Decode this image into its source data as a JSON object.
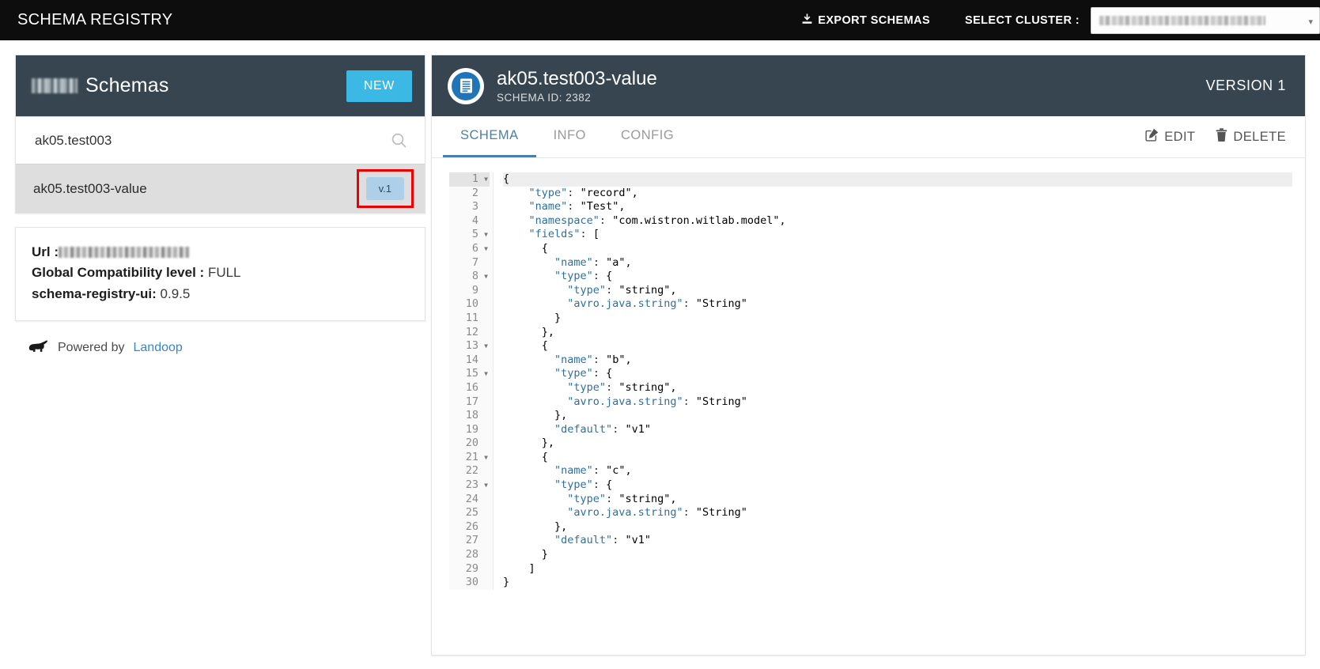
{
  "topnav": {
    "brand": "SCHEMA REGISTRY",
    "export_label": "EXPORT SCHEMAS",
    "export_icon": "download-icon",
    "select_cluster_label": "SELECT CLUSTER :",
    "cluster_value": "",
    "cluster_caret_icon": "chevron-down-icon"
  },
  "sidebar": {
    "header": {
      "count": "",
      "title": "Schemas",
      "new_button": "NEW"
    },
    "search": {
      "value": "ak05.test003",
      "placeholder": "",
      "icon": "search-icon"
    },
    "schemas": [
      {
        "name": "ak05.test003-value",
        "version_badge": "v.1",
        "selected": true,
        "highlighted": true
      }
    ],
    "info": {
      "url_label": "Url :",
      "url_value": "",
      "compat_label": "Global Compatibility level :",
      "compat_value": "FULL",
      "ui_label": "schema-registry-ui:",
      "ui_value": "0.9.5"
    },
    "footer": {
      "powered_by": "Powered by",
      "vendor": "Landoop",
      "logo_icon": "elephant-logo-icon"
    }
  },
  "detail": {
    "icon": "document-icon",
    "title": "ak05.test003-value",
    "schema_id_label": "SCHEMA ID: 2382",
    "version_label": "VERSION 1",
    "tabs": [
      {
        "label": "SCHEMA",
        "active": true
      },
      {
        "label": "INFO",
        "active": false
      },
      {
        "label": "CONFIG",
        "active": false
      }
    ],
    "actions": [
      {
        "label": "EDIT",
        "icon": "pencil-square-icon"
      },
      {
        "label": "DELETE",
        "icon": "trash-icon"
      }
    ]
  },
  "code": {
    "lines": [
      {
        "n": 1,
        "fold": true,
        "text": "{"
      },
      {
        "n": 2,
        "fold": false,
        "text": "    \"type\": \"record\","
      },
      {
        "n": 3,
        "fold": false,
        "text": "    \"name\": \"Test\","
      },
      {
        "n": 4,
        "fold": false,
        "text": "    \"namespace\": \"com.wistron.witlab.model\","
      },
      {
        "n": 5,
        "fold": true,
        "text": "    \"fields\": ["
      },
      {
        "n": 6,
        "fold": true,
        "text": "      {"
      },
      {
        "n": 7,
        "fold": false,
        "text": "        \"name\": \"a\","
      },
      {
        "n": 8,
        "fold": true,
        "text": "        \"type\": {"
      },
      {
        "n": 9,
        "fold": false,
        "text": "          \"type\": \"string\","
      },
      {
        "n": 10,
        "fold": false,
        "text": "          \"avro.java.string\": \"String\""
      },
      {
        "n": 11,
        "fold": false,
        "text": "        }"
      },
      {
        "n": 12,
        "fold": false,
        "text": "      },"
      },
      {
        "n": 13,
        "fold": true,
        "text": "      {"
      },
      {
        "n": 14,
        "fold": false,
        "text": "        \"name\": \"b\","
      },
      {
        "n": 15,
        "fold": true,
        "text": "        \"type\": {"
      },
      {
        "n": 16,
        "fold": false,
        "text": "          \"type\": \"string\","
      },
      {
        "n": 17,
        "fold": false,
        "text": "          \"avro.java.string\": \"String\""
      },
      {
        "n": 18,
        "fold": false,
        "text": "        },"
      },
      {
        "n": 19,
        "fold": false,
        "text": "        \"default\": \"v1\""
      },
      {
        "n": 20,
        "fold": false,
        "text": "      },"
      },
      {
        "n": 21,
        "fold": true,
        "text": "      {"
      },
      {
        "n": 22,
        "fold": false,
        "text": "        \"name\": \"c\","
      },
      {
        "n": 23,
        "fold": true,
        "text": "        \"type\": {"
      },
      {
        "n": 24,
        "fold": false,
        "text": "          \"type\": \"string\","
      },
      {
        "n": 25,
        "fold": false,
        "text": "          \"avro.java.string\": \"String\""
      },
      {
        "n": 26,
        "fold": false,
        "text": "        },"
      },
      {
        "n": 27,
        "fold": false,
        "text": "        \"default\": \"v1\""
      },
      {
        "n": 28,
        "fold": false,
        "text": "      }"
      },
      {
        "n": 29,
        "fold": false,
        "text": "    ]"
      },
      {
        "n": 30,
        "fold": false,
        "text": "}"
      }
    ]
  },
  "colors": {
    "topnav_bg": "#0d0d0d",
    "panel_header_bg": "#36454f",
    "accent_blue": "#3cb8e5",
    "tab_active": "#4b7fa8",
    "highlight_red": "#ee0000",
    "badge_blue": "#aecfe8",
    "link_blue": "#3a85c9"
  }
}
